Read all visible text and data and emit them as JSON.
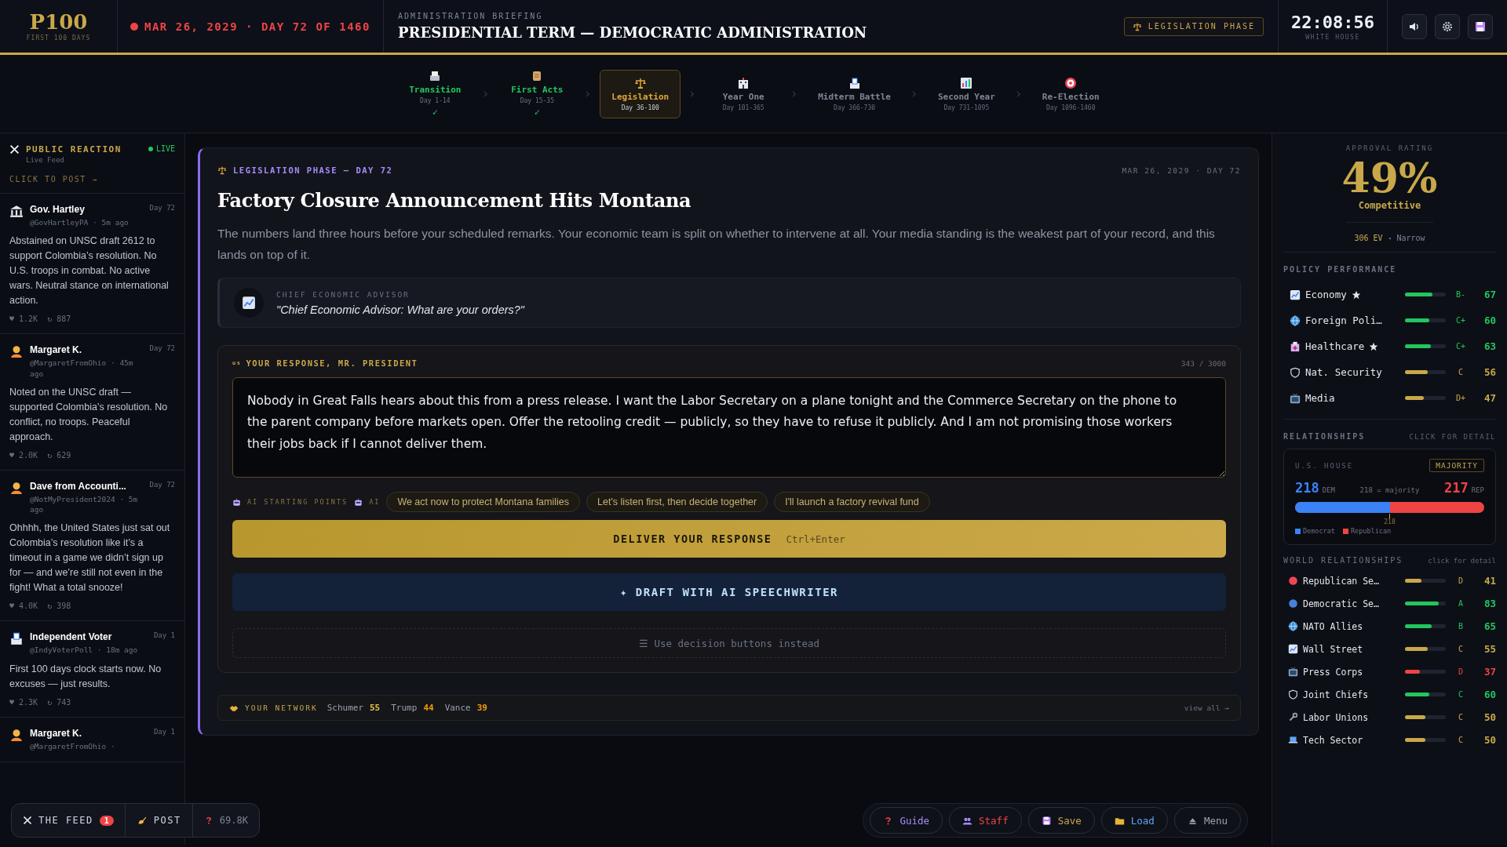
{
  "header": {
    "logo": "P100",
    "logo_sub": "FIRST 100 DAYS",
    "date": "MAR 26, 2029 · DAY 72 OF 1460",
    "briefing_label": "ADMINISTRATION BRIEFING",
    "briefing_title": "PRESIDENTIAL TERM — DEMOCRATIC ADMINISTRATION",
    "phase_badge": "LEGISLATION PHASE",
    "clock": "22:08:56",
    "clock_sub": "WHITE HOUSE"
  },
  "phases": [
    {
      "name": "Transition",
      "days": "Day 1-14",
      "done": true,
      "selected": false,
      "check": "✓"
    },
    {
      "name": "First Acts",
      "days": "Day 15-35",
      "done": true,
      "selected": false,
      "check": "✓"
    },
    {
      "name": "Legislation",
      "days": "Day 36-100",
      "done": false,
      "selected": true
    },
    {
      "name": "Year One",
      "days": "Day 101-365",
      "done": false,
      "selected": false
    },
    {
      "name": "Midterm Battle",
      "days": "Day 366-730",
      "done": false,
      "selected": false
    },
    {
      "name": "Second Year",
      "days": "Day 731-1095",
      "done": false,
      "selected": false
    },
    {
      "name": "Re-Election",
      "days": "Day 1096-1460",
      "done": false,
      "selected": false
    }
  ],
  "feed": {
    "title": "PUBLIC REACTION",
    "subtitle": "Live Feed",
    "live": "LIVE",
    "cta": "CLICK TO POST →",
    "posts": [
      {
        "author": "Gov. Hartley",
        "handle": "@GovHartleyPA · 5m ago",
        "day": "Day 72",
        "body": "Abstained on UNSC draft 2612 to support Colombia’s resolution. No U.S. troops in combat. No active wars. Neutral stance on international action.",
        "likes": "♥ 1.2K",
        "reposts": "↻ 887"
      },
      {
        "author": "Margaret K.",
        "handle": "@MargaretFromOhio · 45m ago",
        "day": "Day 72",
        "body": "Noted on the UNSC draft — supported Colombia’s resolution. No conflict, no troops. Peaceful approach.",
        "likes": "♥ 2.0K",
        "reposts": "↻ 629"
      },
      {
        "author": "Dave from Accounti...",
        "handle": "@NotMyPresident2024 · 5m ago",
        "day": "Day 72",
        "body": "Ohhhh, the United States just sat out Colombia’s resolution like it’s a timeout in a game we didn’t sign up for — and we’re still not even in the fight! What a total snooze!",
        "likes": "♥ 4.0K",
        "reposts": "↻ 398"
      },
      {
        "author": "Independent Voter",
        "handle": "@IndyVoterPoll · 18m ago",
        "day": "Day 1",
        "body": "First 100 days clock starts now. No excuses — just results.",
        "likes": "♥ 2.3K",
        "reposts": "↻ 743"
      },
      {
        "author": "Margaret K.",
        "handle": "@MargaretFromOhio ·",
        "day": "Day 1"
      }
    ]
  },
  "briefing": {
    "phase_label": "LEGISLATION PHASE — DAY 72",
    "date": "MAR 26, 2029 · DAY 72",
    "title": "Factory Closure Announcement Hits Montana",
    "description": "The numbers land three hours before your scheduled remarks. Your economic team is split on whether to intervene at all. Your media standing is the weakest part of your record, and this lands on top of it.",
    "advisor": {
      "role": "CHIEF ECONOMIC ADVISOR",
      "quote": "\"Chief Economic Advisor: What are your orders?\""
    },
    "response": {
      "flag": "us",
      "label": "YOUR RESPONSE, MR. PRESIDENT",
      "count": "343 / 3000",
      "text": "Nobody in Great Falls hears about this from a press release. I want the Labor Secretary on a plane tonight and the Commerce Secretary on the phone to the parent company before markets open. Offer the retooling credit — publicly, so they have to refuse it publicly. And I am not promising those workers their jobs back if I cannot deliver them."
    },
    "starting_points": {
      "label": "AI STARTING POINTS",
      "ai": "AI",
      "chips": [
        "We act now to protect Montana families",
        "Let's listen first, then decide together",
        "I'll launch a factory revival fund"
      ]
    },
    "deliver": {
      "label": "DELIVER YOUR RESPONSE",
      "shortcut": "Ctrl+Enter"
    },
    "draft": "✦ DRAFT WITH AI SPEECHWRITER",
    "decision": "☰ Use decision buttons instead",
    "network": {
      "label": "YOUR NETWORK",
      "people": [
        {
          "name": "Schumer",
          "score": "55",
          "color": "#e8c547"
        },
        {
          "name": "Trump",
          "score": "44",
          "color": "#f59e0b"
        },
        {
          "name": "Vance",
          "score": "39",
          "color": "#f59e0b"
        }
      ],
      "link": "view all →"
    }
  },
  "approval": {
    "label": "APPROVAL RATING",
    "value": "49%",
    "verdict": "Competitive",
    "ev": "306 EV",
    "margin": "Narrow"
  },
  "policy": {
    "title": "POLICY PERFORMANCE",
    "items": [
      {
        "name": "Economy",
        "starred": true,
        "grade": "B-",
        "score": "67",
        "level": 0.67,
        "color": "#22c55e"
      },
      {
        "name": "Foreign Poli…",
        "starred": false,
        "grade": "C+",
        "score": "60",
        "level": 0.6,
        "color": "#22c55e"
      },
      {
        "name": "Healthcare",
        "starred": true,
        "grade": "C+",
        "score": "63",
        "level": 0.63,
        "color": "#22c55e"
      },
      {
        "name": "Nat. Security",
        "starred": false,
        "grade": "C",
        "score": "56",
        "level": 0.56,
        "color": "#c9a84a"
      },
      {
        "name": "Media",
        "starred": false,
        "grade": "D+",
        "score": "47",
        "level": 0.47,
        "color": "#c9a84a"
      }
    ]
  },
  "relationships": {
    "title": "RELATIONSHIPS",
    "hint": "CLICK FOR DETAIL",
    "house": {
      "label": "U.S. HOUSE",
      "badge": "MAJORITY",
      "dem": "218",
      "dem_label": "DEM",
      "middle": "218 = majority",
      "rep": "217",
      "rep_label": "REP",
      "level": 0.5,
      "marker": "218",
      "legend": [
        "Democrat",
        "Republican"
      ]
    }
  },
  "world": {
    "title": "WORLD RELATIONSHIPS",
    "hint": "click for detail",
    "items": [
      {
        "name": "Republican Se…",
        "grade": "D",
        "score": "41",
        "level": 0.41,
        "color": "#c9a84a"
      },
      {
        "name": "Democratic Se…",
        "grade": "A",
        "score": "83",
        "level": 0.83,
        "color": "#22c55e"
      },
      {
        "name": "NATO Allies",
        "grade": "B",
        "score": "65",
        "level": 0.65,
        "color": "#22c55e"
      },
      {
        "name": "Wall Street",
        "grade": "C",
        "score": "55",
        "level": 0.55,
        "color": "#c9a84a"
      },
      {
        "name": "Press Corps",
        "grade": "D",
        "score": "37",
        "level": 0.37,
        "color": "#ef4444"
      },
      {
        "name": "Joint Chiefs",
        "grade": "C",
        "score": "60",
        "level": 0.6,
        "color": "#22c55e"
      },
      {
        "name": "Labor Unions",
        "grade": "C",
        "score": "50",
        "level": 0.5,
        "color": "#c9a84a"
      },
      {
        "name": "Tech Sector",
        "grade": "C",
        "score": "50",
        "level": 0.5,
        "color": "#c9a84a"
      }
    ]
  },
  "feed_bar": {
    "feed": "THE FEED",
    "unread": "1",
    "post": "POST",
    "stat": "69.8K"
  },
  "menu_bar": [
    {
      "label": "Guide",
      "color": "#a78bfa"
    },
    {
      "label": "Staff",
      "color": "#ef4444"
    },
    {
      "label": "Save",
      "color": "#c9a84a"
    },
    {
      "label": "Load",
      "color": "#60a5fa"
    },
    {
      "label": "Menu",
      "color": "#9ca3af"
    }
  ]
}
